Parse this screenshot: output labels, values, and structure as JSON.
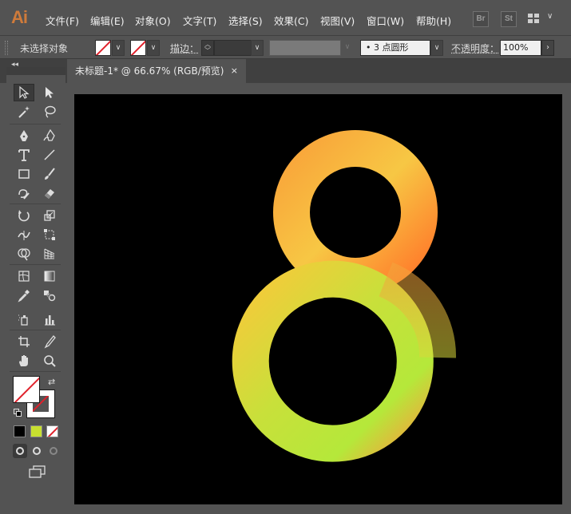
{
  "app": {
    "logo_text": "Ai"
  },
  "menu": {
    "items": [
      "文件(F)",
      "编辑(E)",
      "对象(O)",
      "文字(T)",
      "选择(S)",
      "效果(C)",
      "视图(V)",
      "窗口(W)",
      "帮助(H)"
    ],
    "bridge_label": "Br",
    "stock_label": "St"
  },
  "control_bar": {
    "selection_status": "未选择对象",
    "stroke_label": "描边：",
    "brush_value": "• 3 点圆形",
    "opacity_label": "不透明度：",
    "opacity_value": "100%"
  },
  "document_tab": {
    "title": "未标题-1* @ 66.67% (RGB/预览)",
    "close_glyph": "×"
  },
  "tools": [
    "selection-tool",
    "direct-selection-tool",
    "magic-wand-tool",
    "lasso-tool",
    "pen-tool",
    "curvature-tool",
    "type-tool",
    "line-segment-tool",
    "rectangle-tool",
    "paintbrush-tool",
    "shaper-tool",
    "eraser-tool",
    "rotate-tool",
    "scale-tool",
    "width-tool",
    "free-transform-tool",
    "shape-builder-tool",
    "perspective-grid-tool",
    "mesh-tool",
    "gradient-tool",
    "eyedropper-tool",
    "blend-tool",
    "symbol-sprayer-tool",
    "column-graph-tool",
    "artboard-tool",
    "slice-tool",
    "hand-tool",
    "zoom-tool"
  ],
  "colors": {
    "ui_bg": "#535353",
    "artboard": "#000000",
    "gradient_stops": [
      "#f9a43a",
      "#f7c744",
      "#c8e03a",
      "#b5e83a",
      "#f2a53c"
    ],
    "mode_swatches": [
      "#000000",
      "#c8e030",
      "none"
    ]
  },
  "artwork": {
    "shape": "number-8-gradient-stroke"
  }
}
